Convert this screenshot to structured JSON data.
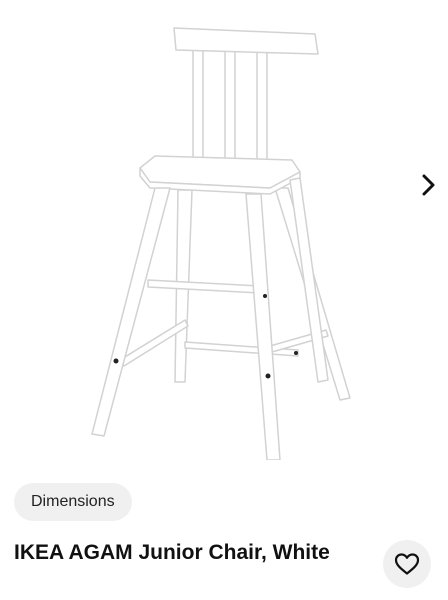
{
  "product": {
    "name": "IKEA AGAM Junior Chair, White",
    "image_alt_icon": "white-junior-chair-photo"
  },
  "gallery": {
    "next_icon": "chevron-right-icon"
  },
  "chips": {
    "dimensions_label": "Dimensions"
  },
  "actions": {
    "favorite_icon": "heart-outline-icon"
  },
  "colors": {
    "chip_bg": "#f0f0f0",
    "text": "#111111",
    "background": "#ffffff"
  }
}
